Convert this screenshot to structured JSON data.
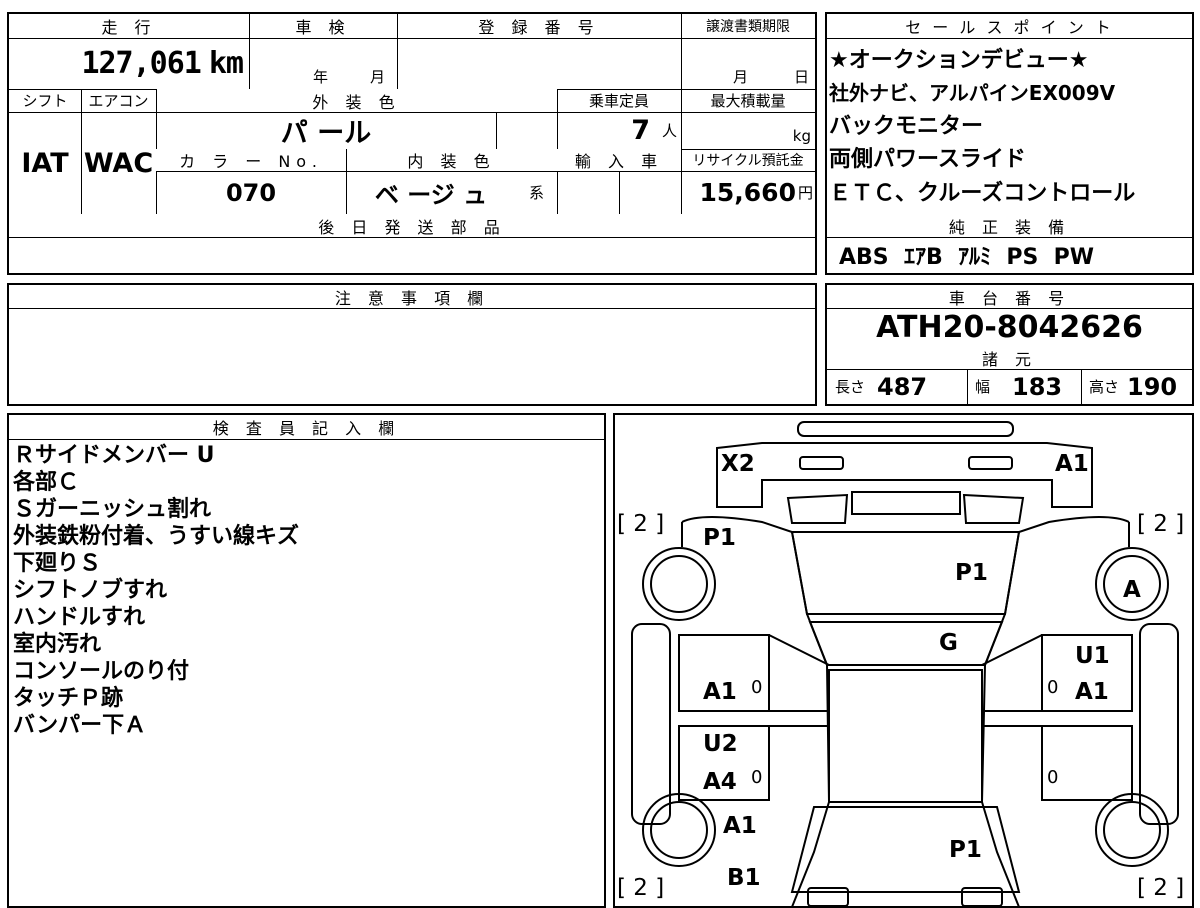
{
  "top_left": {
    "headers": {
      "mileage": "走 行",
      "inspection": "車 検",
      "reg_number": "登 録 番 号",
      "transfer_limit": "譲渡書類期限"
    },
    "mileage_value": "127,061",
    "mileage_unit": "km",
    "inspection_year": "年",
    "inspection_month": "月",
    "transfer_month": "月",
    "transfer_day": "日",
    "labels2": {
      "shift": "シフト",
      "aircon": "エアコン",
      "exterior_color": "外 装 色",
      "capacity": "乗車定員",
      "max_load": "最大積載量"
    },
    "shift_value": "IAT",
    "aircon_value": "WAC",
    "exterior_color_value": "パ ール",
    "capacity_value": "7",
    "capacity_unit": "人",
    "max_load_unit": "kg",
    "labels3": {
      "color_no": "カ ラ ー No.",
      "interior_color": "内 装 色",
      "imported": "輸 入 車",
      "recycle": "リサイクル預託金"
    },
    "color_no_value": "070",
    "interior_color_value": "ベ ージ ュ",
    "interior_suffix": "系",
    "recycle_value": "15,660",
    "recycle_unit": "円",
    "later_parts_header": "後 日 発 送 部 品"
  },
  "sales_points": {
    "header": "セ ー ル ス ポ イ ン ト",
    "lines": [
      "★オークションデビュー★",
      "社外ナビ、アルパインEX009V",
      "バックモニター",
      "両側パワースライド",
      "ＥＴＣ、クルーズコントロール"
    ]
  },
  "genuine_equipment": {
    "header": "純 正 装 備",
    "value": "ABS  ｴｱB  ｱﾙﾐ  PS  PW"
  },
  "caution": {
    "header": "注 意 事 項 欄"
  },
  "chassis": {
    "header": "車 台 番 号",
    "value": "ATH20-8042626"
  },
  "specs": {
    "header": "諸 元",
    "length_label": "長さ",
    "length_value": "487",
    "width_label": "幅",
    "width_value": "183",
    "height_label": "高さ",
    "height_value": "190"
  },
  "inspector": {
    "header": "検 査 員 記 入 欄",
    "notes": [
      "Ｒサイドメンバー U",
      "各部Ｃ",
      "Ｓガーニッシュ割れ",
      "外装鉄粉付着、うすい線キズ",
      "下廻りＳ",
      "シフトノブすれ",
      "ハンドルすれ",
      "室内汚れ",
      "コンソールのり付",
      "タッチＰ跡",
      "バンパー下Ａ"
    ]
  },
  "diagram": {
    "labels": {
      "x2": "X2",
      "a1_top": "A1",
      "bracket_tl": "[ 2 ]",
      "bracket_tr": "[ 2 ]",
      "bracket_bl": "[ 2 ]",
      "bracket_br": "[ 2 ]",
      "p1_left": "P1",
      "p1_hood": "P1",
      "a_wheel": "A",
      "g_glass": "G",
      "u1_right": "U1",
      "a1_right": "A1",
      "a1_left": "A1",
      "u2_left": "U2",
      "a4_left": "A4",
      "a1_left_rear": "A1",
      "b1_left": "B1",
      "p1_rear": "P1",
      "zero": "0"
    }
  }
}
